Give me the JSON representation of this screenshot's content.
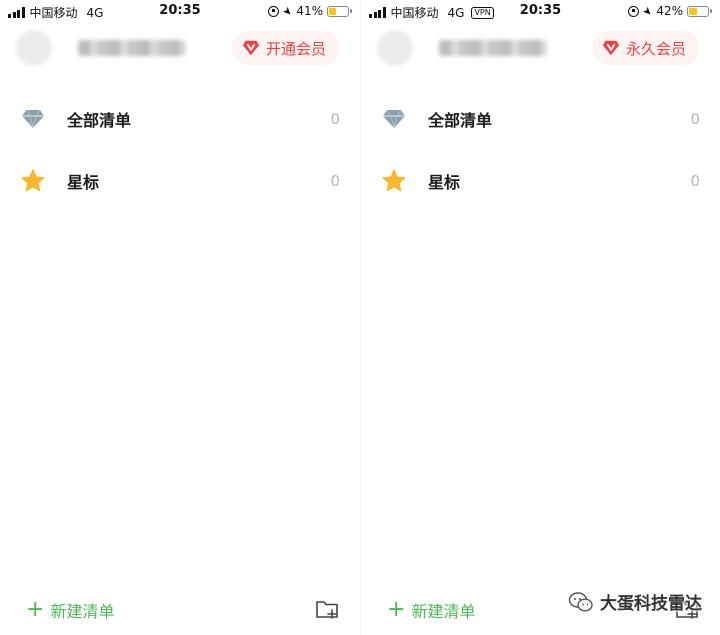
{
  "screens": [
    {
      "status_bar": {
        "carrier": "中国移动",
        "network": "4G",
        "vpn": "",
        "time": "20:35",
        "battery": "41%",
        "battery_level": 0.41
      },
      "header": {
        "vip_label": "开通会员"
      },
      "lists": [
        {
          "label": "全部清单",
          "count": "0",
          "icon": "diamond-icon"
        },
        {
          "label": "星标",
          "count": "0",
          "icon": "star-icon"
        }
      ],
      "footer": {
        "new_list_label": "新建清单",
        "new_list_icon": "plus-icon",
        "folder_icon": "new-folder-icon"
      }
    },
    {
      "status_bar": {
        "carrier": "中国移动",
        "network": "4G",
        "vpn": "VPN",
        "time": "20:35",
        "battery": "42%",
        "battery_level": 0.42
      },
      "header": {
        "vip_label": "永久会员"
      },
      "lists": [
        {
          "label": "全部清单",
          "count": "0",
          "icon": "diamond-icon"
        },
        {
          "label": "星标",
          "count": "0",
          "icon": "star-icon"
        }
      ],
      "footer": {
        "new_list_label": "新建清单",
        "new_list_icon": "plus-icon",
        "folder_icon": "new-folder-icon"
      }
    }
  ],
  "watermark": {
    "text": "大蛋科技雷达",
    "icon": "wechat-icon"
  },
  "colors": {
    "accent_green": "#4fb555",
    "vip_red": "#e64545",
    "star_yellow": "#f5b82e",
    "diamond_gray": "#8aa0ad"
  }
}
